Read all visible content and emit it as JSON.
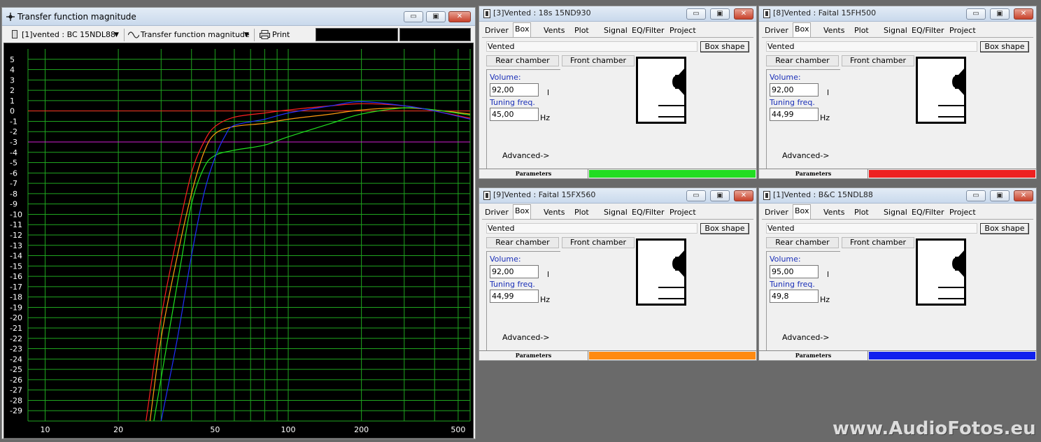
{
  "graph_window": {
    "title": "Transfer function magnitude",
    "driver_select": "[1]vented : BC 15NDL88",
    "view_select": "Transfer function magnitude",
    "print_label": "Print"
  },
  "chart_data": {
    "type": "line",
    "xscale": "log",
    "xlim": [
      8.5,
      560
    ],
    "ylim": [
      -30,
      6
    ],
    "xticks": [
      "10",
      "20",
      "50",
      "100",
      "200",
      "500"
    ],
    "yticks": [
      "5",
      "4",
      "3",
      "2",
      "1",
      "0",
      "-1",
      "-2",
      "-3",
      "-4",
      "-5",
      "-6",
      "-7",
      "-8",
      "-9",
      "-10",
      "-11",
      "-12",
      "-13",
      "-14",
      "-15",
      "-16",
      "-17",
      "-18",
      "-19",
      "-20",
      "-21",
      "-22",
      "-23",
      "-24",
      "-25",
      "-26",
      "-27",
      "-28",
      "-29"
    ],
    "reference_lines": [
      {
        "y": 0,
        "color": "#ff2020"
      },
      {
        "y": -3,
        "color": "#d020d0"
      }
    ],
    "grid": true,
    "background": "#000000",
    "grid_color": "#1fa51f",
    "series": [
      {
        "color": "#ff2020",
        "points": [
          [
            26,
            -30
          ],
          [
            30,
            -20
          ],
          [
            35,
            -12
          ],
          [
            40,
            -6
          ],
          [
            45,
            -3
          ],
          [
            50,
            -1.5
          ],
          [
            60,
            -0.6
          ],
          [
            80,
            -0.2
          ],
          [
            100,
            0.1
          ],
          [
            150,
            0.5
          ],
          [
            200,
            0.7
          ],
          [
            300,
            0.5
          ],
          [
            400,
            0
          ],
          [
            560,
            -0.7
          ]
        ]
      },
      {
        "color": "#ff9a10",
        "points": [
          [
            27,
            -30
          ],
          [
            30,
            -22
          ],
          [
            35,
            -14
          ],
          [
            40,
            -8
          ],
          [
            45,
            -4
          ],
          [
            50,
            -2.2
          ],
          [
            60,
            -1.5
          ],
          [
            80,
            -1.2
          ],
          [
            100,
            -0.8
          ],
          [
            150,
            -0.3
          ],
          [
            200,
            0.1
          ],
          [
            300,
            0.3
          ],
          [
            400,
            0.1
          ],
          [
            560,
            -0.3
          ]
        ]
      },
      {
        "color": "#20e020",
        "points": [
          [
            28,
            -30
          ],
          [
            32,
            -22
          ],
          [
            36,
            -15
          ],
          [
            40,
            -9
          ],
          [
            45,
            -5.5
          ],
          [
            50,
            -4.3
          ],
          [
            60,
            -3.8
          ],
          [
            80,
            -3.3
          ],
          [
            100,
            -2.5
          ],
          [
            150,
            -1.2
          ],
          [
            200,
            -0.3
          ],
          [
            300,
            0.3
          ],
          [
            400,
            0.1
          ],
          [
            560,
            -0.4
          ]
        ]
      },
      {
        "color": "#2030ff",
        "points": [
          [
            30,
            -30
          ],
          [
            35,
            -22
          ],
          [
            40,
            -14
          ],
          [
            45,
            -8
          ],
          [
            50,
            -4.5
          ],
          [
            55,
            -2.4
          ],
          [
            60,
            -1.4
          ],
          [
            80,
            -0.8
          ],
          [
            100,
            -0.2
          ],
          [
            150,
            0.5
          ],
          [
            200,
            0.9
          ],
          [
            300,
            0.5
          ],
          [
            400,
            0
          ],
          [
            560,
            -0.8
          ]
        ]
      }
    ]
  },
  "speaker_windows": [
    {
      "title": "[3]Vented : 18s 15ND930",
      "mode": "Vented",
      "volume": "92,00",
      "tuning": "45,00",
      "bar_color": "#22dd22"
    },
    {
      "title": "[8]Vented : Faital 15FH500",
      "mode": "Vented",
      "volume": "92,00",
      "tuning": "44,99",
      "bar_color": "#ee2020"
    },
    {
      "title": "[9]Vented : Faital 15FX560",
      "mode": "Vented",
      "volume": "92,00",
      "tuning": "44,99",
      "bar_color": "#ff8a10"
    },
    {
      "title": "[1]Vented : B&C 15NDL88",
      "mode": "Vented",
      "volume": "95,00",
      "tuning": "49,8",
      "bar_color": "#1020ee"
    }
  ],
  "common": {
    "tabs": [
      "Driver",
      "Box",
      "Vents",
      "Plot",
      "Signal",
      "EQ/Filter",
      "Project"
    ],
    "box_shape_label": "Box shape",
    "rear_chamber": "Rear chamber",
    "front_chamber": "Front chamber",
    "volume_label": "Volume:",
    "volume_unit": "l",
    "tuning_label": "Tuning freq.",
    "tuning_unit": "Hz",
    "advanced_label": "Advanced->",
    "parameters_label": "Parameters",
    "minimize": "▭",
    "maximize": "▣",
    "close": "✕"
  },
  "watermark": "www.AudioFotos.eu"
}
